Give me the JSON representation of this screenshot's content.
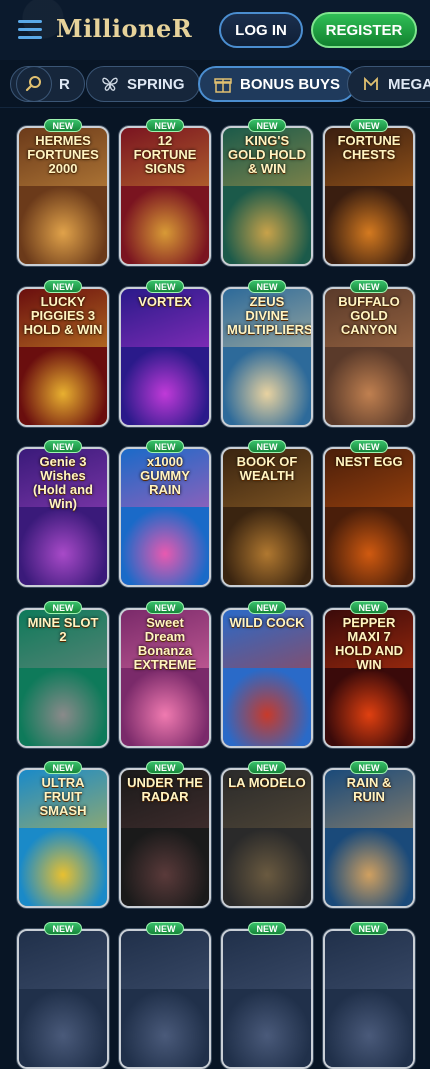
{
  "header": {
    "menu_icon": "hamburger-icon",
    "logo": "MillioneR",
    "login_label": "LOG IN",
    "register_label": "REGISTER"
  },
  "filters": {
    "search_icon": "search-icon",
    "items": [
      {
        "label": "R",
        "icon": ""
      },
      {
        "label": "SPRING",
        "icon": "butterfly-icon"
      },
      {
        "label": "BONUS BUYS",
        "icon": "gift-icon",
        "active": true
      },
      {
        "label": "MEGAW",
        "icon": "m-icon"
      }
    ]
  },
  "badge_label": "NEW",
  "games": [
    {
      "title": "HERMES FORTUNES 2000",
      "colors": [
        "#6b3a1a",
        "#e0a24a"
      ]
    },
    {
      "title": "12 FORTUNE SIGNS",
      "colors": [
        "#7a1420",
        "#d89a36"
      ]
    },
    {
      "title": "KING'S GOLD HOLD & WIN",
      "colors": [
        "#1b5a4a",
        "#c8a24a"
      ]
    },
    {
      "title": "FORTUNE CHESTS",
      "colors": [
        "#3a1e10",
        "#d47a20"
      ]
    },
    {
      "title": "LUCKY PIGGIES 3 HOLD & WIN",
      "colors": [
        "#6a0e0e",
        "#e8b030"
      ]
    },
    {
      "title": "VORTEX",
      "colors": [
        "#2a1a8a",
        "#c03ad8"
      ]
    },
    {
      "title": "ZEUS DIVINE MULTIPLIERS",
      "colors": [
        "#2d6a9a",
        "#e8d2a0"
      ]
    },
    {
      "title": "BUFFALO GOLD CANYON",
      "colors": [
        "#5a3a2a",
        "#c08050"
      ]
    },
    {
      "title": "Genie 3 Wishes (Hold and Win)",
      "colors": [
        "#3a1a7a",
        "#a84ac8"
      ]
    },
    {
      "title": "x1000 GUMMY RAIN",
      "colors": [
        "#1a6ac8",
        "#e85ab0"
      ]
    },
    {
      "title": "BOOK OF WEALTH",
      "colors": [
        "#3a2410",
        "#b07830"
      ]
    },
    {
      "title": "NEST EGG",
      "colors": [
        "#4a1e0a",
        "#d05a10"
      ]
    },
    {
      "title": "MINE SLOT 2",
      "colors": [
        "#0e7a5a",
        "#8a8a8a"
      ]
    },
    {
      "title": "Sweet Dream Bonanza EXTREME",
      "colors": [
        "#7a2a6a",
        "#f07ab0"
      ]
    },
    {
      "title": "WILD COCK",
      "colors": [
        "#2a6ac8",
        "#c83a2a"
      ]
    },
    {
      "title": "PEPPER MAXI 7 HOLD AND WIN",
      "colors": [
        "#3a0a0a",
        "#e04010"
      ]
    },
    {
      "title": "ULTRA FRUIT SMASH",
      "colors": [
        "#1a8ac8",
        "#e8c030"
      ]
    },
    {
      "title": "UNDER THE RADAR",
      "colors": [
        "#1a1a1a",
        "#5a3a3a"
      ]
    },
    {
      "title": "LA MODELO",
      "colors": [
        "#2a2a2a",
        "#6a5a40"
      ]
    },
    {
      "title": "RAIN & RUIN",
      "colors": [
        "#1a4a7a",
        "#d0a060"
      ]
    },
    {
      "title": "",
      "colors": [
        "#20304a",
        "#4a5a7a"
      ]
    },
    {
      "title": "",
      "colors": [
        "#20304a",
        "#4a5a7a"
      ]
    },
    {
      "title": "",
      "colors": [
        "#20304a",
        "#4a5a7a"
      ]
    },
    {
      "title": "",
      "colors": [
        "#20304a",
        "#4a5a7a"
      ]
    }
  ]
}
